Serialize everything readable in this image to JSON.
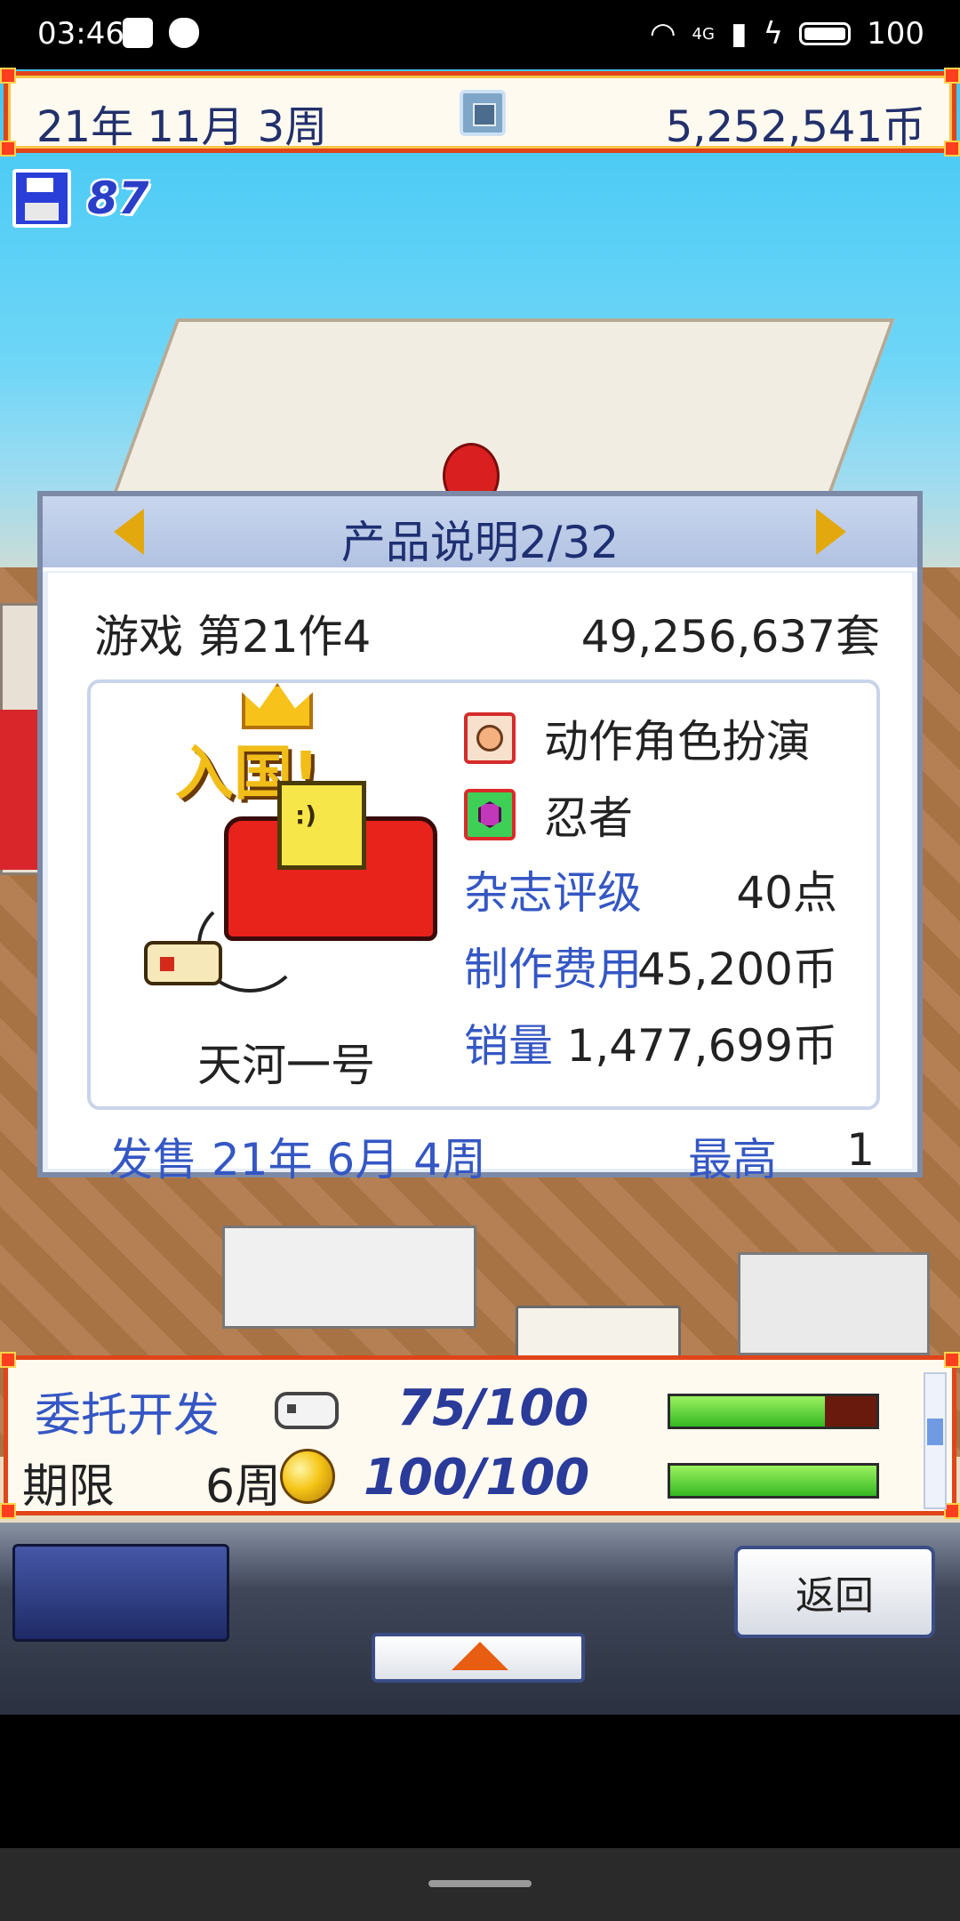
{
  "status_bar": {
    "time": "03:46",
    "network": "4G",
    "battery": "100",
    "icons": [
      "mail-icon",
      "shield-icon",
      "wifi-icon",
      "signal-icon",
      "charging-icon",
      "battery-icon"
    ]
  },
  "top_hud": {
    "date": "21年 11月 3周",
    "money": "5,252,541币"
  },
  "save": {
    "count": "87"
  },
  "dialog": {
    "title": "产品说明2/32",
    "game_title": "游戏 第21作4",
    "total_sales": "49,256,637套",
    "award_text": "入国!",
    "console_face": ":)",
    "console_name": "天河一号",
    "genre": "动作角色扮演",
    "theme": "忍者",
    "magazine_label": "杂志评级",
    "magazine_value": "40点",
    "cost_label": "制作费用",
    "cost_value": "45,200币",
    "sales_label": "销量",
    "sales_value": "1,477,699币",
    "release_label": "发售 21年 6月 4周",
    "best_label": "最高",
    "best_value": "1"
  },
  "bottom_hud": {
    "contract_label": "委托开发",
    "progress1": "75/100",
    "progress1_fraction": 0.75,
    "deadline_label": "期限",
    "deadline_value": "6周",
    "progress2": "100/100",
    "progress2_fraction": 1.0
  },
  "bottom_panel": {
    "back_label": "返回"
  },
  "colors": {
    "hud_border": "#e04419",
    "label_blue": "#3557c4",
    "title_navy": "#1f2f72",
    "progress_green": "#34b823",
    "arrow_gold": "#e2a80e"
  }
}
